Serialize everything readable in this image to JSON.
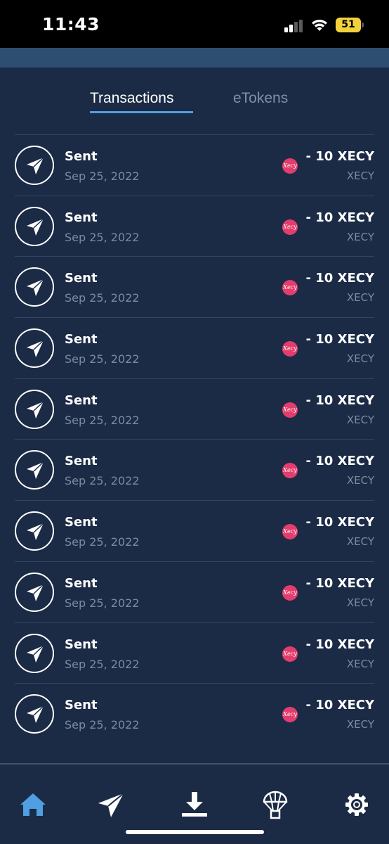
{
  "status_bar": {
    "time": "11:43",
    "battery": "51"
  },
  "tabs": [
    {
      "label": "Transactions",
      "active": true
    },
    {
      "label": "eTokens",
      "active": false
    }
  ],
  "transactions": [
    {
      "type": "Sent",
      "date": "Sep 25, 2022",
      "amount": "- 10 XECY",
      "ticker": "XECY",
      "token_logo_text": "Xecy"
    },
    {
      "type": "Sent",
      "date": "Sep 25, 2022",
      "amount": "- 10 XECY",
      "ticker": "XECY",
      "token_logo_text": "Xecy"
    },
    {
      "type": "Sent",
      "date": "Sep 25, 2022",
      "amount": "- 10 XECY",
      "ticker": "XECY",
      "token_logo_text": "Xecy"
    },
    {
      "type": "Sent",
      "date": "Sep 25, 2022",
      "amount": "- 10 XECY",
      "ticker": "XECY",
      "token_logo_text": "Xecy"
    },
    {
      "type": "Sent",
      "date": "Sep 25, 2022",
      "amount": "- 10 XECY",
      "ticker": "XECY",
      "token_logo_text": "Xecy"
    },
    {
      "type": "Sent",
      "date": "Sep 25, 2022",
      "amount": "- 10 XECY",
      "ticker": "XECY",
      "token_logo_text": "Xecy"
    },
    {
      "type": "Sent",
      "date": "Sep 25, 2022",
      "amount": "- 10 XECY",
      "ticker": "XECY",
      "token_logo_text": "Xecy"
    },
    {
      "type": "Sent",
      "date": "Sep 25, 2022",
      "amount": "- 10 XECY",
      "ticker": "XECY",
      "token_logo_text": "Xecy"
    },
    {
      "type": "Sent",
      "date": "Sep 25, 2022",
      "amount": "- 10 XECY",
      "ticker": "XECY",
      "token_logo_text": "Xecy"
    },
    {
      "type": "Sent",
      "date": "Sep 25, 2022",
      "amount": "- 10 XECY",
      "ticker": "XECY",
      "token_logo_text": "Xecy"
    }
  ],
  "icons": {
    "transaction": "paper-plane-icon",
    "token": "xecy-token-icon"
  },
  "nav": [
    {
      "icon": "home-icon",
      "active": true
    },
    {
      "icon": "send-icon",
      "active": false
    },
    {
      "icon": "receive-icon",
      "active": false
    },
    {
      "icon": "airdrop-icon",
      "active": false
    },
    {
      "icon": "settings-icon",
      "active": false
    }
  ],
  "colors": {
    "background": "#1b2a45",
    "header_band": "#2d4e70",
    "accent": "#4f9fe2",
    "token": "#e23d6d",
    "muted_text": "#7d8aa0"
  }
}
